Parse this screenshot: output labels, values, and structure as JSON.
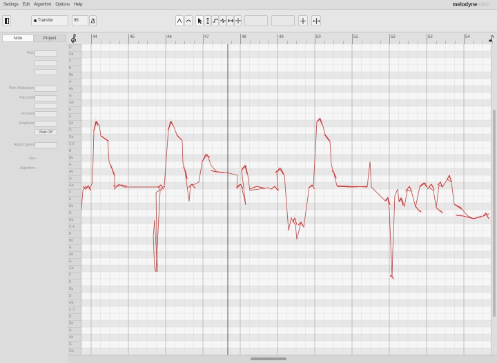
{
  "menu": [
    "Settings",
    "Edit",
    "Algorithm",
    "Options",
    "Help"
  ],
  "brand": {
    "name": "melodyne",
    "edition": "editor"
  },
  "toolbar": {
    "transfer_label": "Transfer",
    "tempo_value": "95"
  },
  "sidebar": {
    "tabs": [
      {
        "label": "Note",
        "active": true
      },
      {
        "label": "Project",
        "active": false
      }
    ],
    "params": [
      {
        "label": "Pitch",
        "value": ""
      },
      {
        "label": "",
        "value": ""
      },
      {
        "label": "",
        "value": ""
      },
      {
        "label": "Pitch Modulation",
        "value": ""
      },
      {
        "label": "Pitch Drift",
        "value": ""
      },
      {
        "label": "",
        "value": ""
      },
      {
        "label": "Formant",
        "value": ""
      },
      {
        "label": "Amplitude",
        "value": ""
      },
      {
        "label": "",
        "value": "Note Off"
      },
      {
        "label": "Attack Speed",
        "value": ""
      },
      {
        "label": "File",
        "value": "---"
      },
      {
        "label": "Algorithm",
        "value": "---"
      }
    ]
  },
  "ruler": {
    "bars": [
      "44",
      "45",
      "46",
      "47",
      "48",
      "49",
      "50",
      "51",
      "52",
      "53",
      "54"
    ]
  },
  "keys": [
    "D",
    "Db",
    "C",
    "B",
    "Bb",
    "A",
    "Ab",
    "G",
    "Gb",
    "F",
    "E",
    "Eb",
    "D",
    "Db",
    "C 5",
    "B",
    "Bb",
    "A",
    "Ab",
    "G",
    "Gb",
    "F",
    "E",
    "Eb",
    "D",
    "Db",
    "C 4",
    "B",
    "Bb",
    "A",
    "Ab",
    "G",
    "Gb",
    "F",
    "E",
    "Eb",
    "D",
    "Db",
    "C 3",
    "B",
    "Bb",
    "A",
    "Ab",
    "G",
    "Gb"
  ],
  "colors": {
    "blob": "#b13a3a",
    "blob_fill": "#f6e4e4",
    "playhead": "#555555",
    "accent": "#2b2b2b"
  },
  "icons": [
    "window-toggle-icon",
    "record-dot-icon",
    "metronome-icon",
    "main-tool-icon",
    "pitch-tool-icon",
    "pointer-icon",
    "formant-tool-icon",
    "amplitude-tool-icon",
    "timing-tool-icon",
    "snap-icon",
    "scroll-icon",
    "treble-clef-icon",
    "note-icon"
  ]
}
